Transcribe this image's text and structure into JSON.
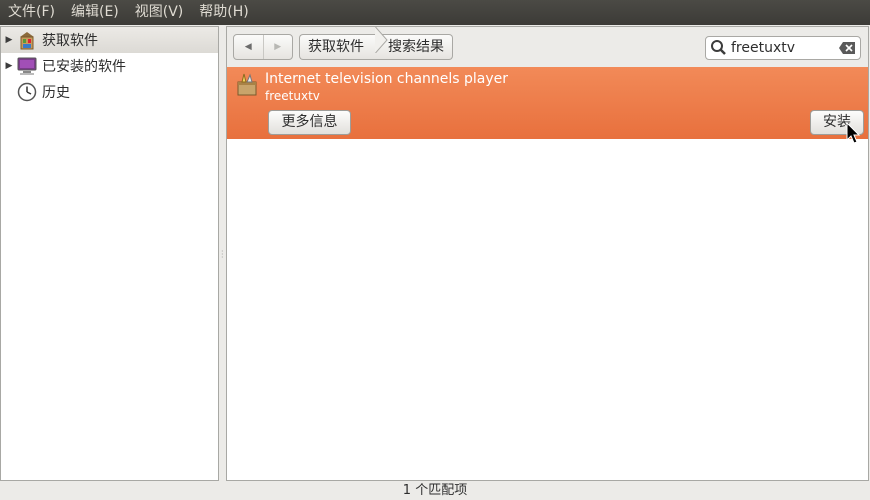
{
  "menubar": {
    "items": [
      "文件(F)",
      "编辑(E)",
      "视图(V)",
      "帮助(H)"
    ]
  },
  "sidebar": {
    "items": [
      {
        "label": "获取软件",
        "icon": "software-center-icon",
        "expandable": true,
        "selected": true
      },
      {
        "label": "已安装的软件",
        "icon": "computer-icon",
        "expandable": true,
        "selected": false
      },
      {
        "label": "历史",
        "icon": "clock-icon",
        "expandable": false,
        "selected": false
      }
    ]
  },
  "toolbar": {
    "back_icon": "back-arrow-icon",
    "forward_icon": "forward-arrow-icon",
    "breadcrumbs": [
      "获取软件",
      "搜索结果"
    ],
    "search_value": "freetuxtv"
  },
  "results": [
    {
      "title": "Internet television channels player",
      "package": "freetuxtv",
      "more_info_label": "更多信息",
      "install_label": "安装"
    }
  ],
  "status": {
    "text": "1 个匹配项"
  },
  "colors": {
    "selected_row": "#ed7a47",
    "menubar_bg": "#3c3b37"
  }
}
